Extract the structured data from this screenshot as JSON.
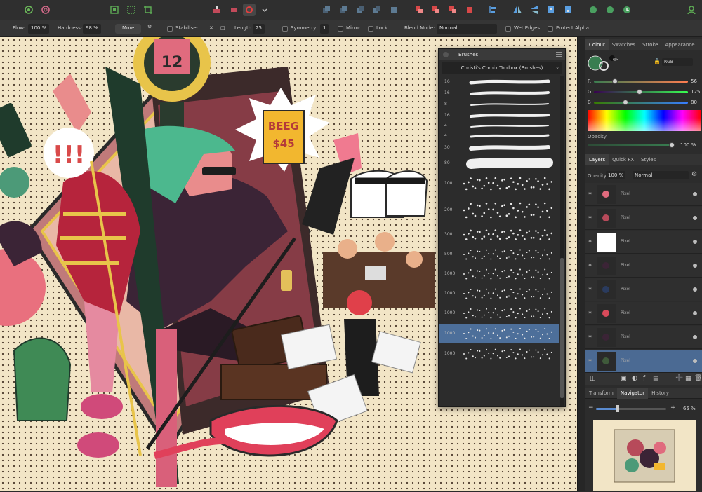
{
  "context_bar": {
    "flow_label": "Flow:",
    "flow_value": "100 %",
    "hardness_label": "Hardness:",
    "hardness_value": "98 %",
    "more_label": "More",
    "stabiliser_label": "Stabiliser",
    "length_label": "Length",
    "length_value": "25",
    "symmetry_label": "Symmetry",
    "symmetry_value": "1",
    "mirror_label": "Mirror",
    "lock_label": "Lock",
    "blend_label": "Blend Mode:",
    "blend_value": "Normal",
    "wet_edges_label": "Wet Edges",
    "protect_alpha_label": "Protect Alpha"
  },
  "brushes_panel": {
    "title": "Brushes",
    "category": "Christi's Comix Toolbox (Brushes)",
    "sizes": [
      "16",
      "16",
      "8",
      "16",
      "4",
      "4",
      "30",
      "80",
      "100",
      "200",
      "300",
      "500",
      "1000",
      "1000",
      "1000",
      "1000",
      "1000"
    ]
  },
  "colour_panel": {
    "tabs": [
      "Colour",
      "Swatches",
      "Stroke",
      "Appearance"
    ],
    "model": "RGB",
    "r_label": "R",
    "r_value": "56",
    "g_label": "G",
    "g_value": "125",
    "b_label": "B",
    "b_value": "80",
    "opacity_label": "Opacity",
    "opacity_value": "100 %",
    "current_color": "#387d50"
  },
  "layers_panel": {
    "tabs": [
      "Layers",
      "Quick FX",
      "Styles"
    ],
    "opacity_label": "Opacity:",
    "opacity_value": "100 %",
    "blend_value": "Normal",
    "layer_name": "Pixel"
  },
  "navigator_panel": {
    "tabs": [
      "Transform",
      "Navigator",
      "History"
    ],
    "zoom_value": "65 %"
  },
  "artwork": {
    "sign_number": "12",
    "book_line1": "BEEG",
    "book_line2": "$45",
    "speech_text": "!!!"
  }
}
